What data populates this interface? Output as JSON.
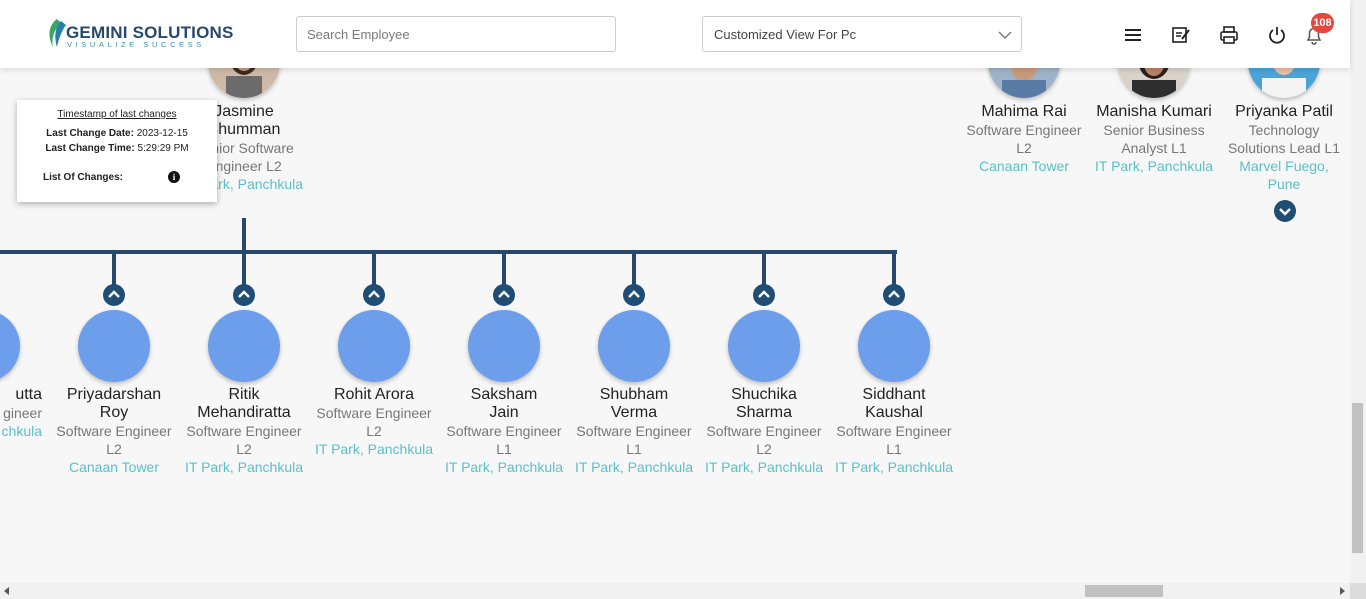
{
  "header": {
    "logo_name": "GEMINI SOLUTIONS",
    "logo_tagline": "VISUALIZE SUCCESS",
    "search_placeholder": "Search Employee",
    "view_select": "Customized View For Pc",
    "notification_count": "108",
    "icons": [
      "menu-icon",
      "edit-note-icon",
      "print-icon",
      "power-icon",
      "bell-icon"
    ]
  },
  "popup": {
    "title": "Timestamp of last changes",
    "date_label": "Last Change Date:",
    "date_value": "2023-12-15",
    "time_label": "Last Change Time:",
    "time_value": "5:29:29 PM",
    "changes_label": "List Of Changes:"
  },
  "manager": {
    "name": "Jasmine Bhumman",
    "role": "Senior Software Engineer L2",
    "location": "IT Park, Panchkula"
  },
  "top_right_nodes": [
    {
      "name": "Mahima Rai",
      "role": "Software Engineer L2",
      "location": "Canaan Tower"
    },
    {
      "name": "Manisha Kumari",
      "role": "Senior Business Analyst L1",
      "location": "IT Park, Panchkula"
    },
    {
      "name": "Priyanka Patil",
      "role": "Technology Solutions Lead L1",
      "location": "Marvel Fuego, Pune"
    }
  ],
  "children": [
    {
      "name": "utta",
      "role": "gineer",
      "location": "chkula"
    },
    {
      "name": "Priyadarshan Roy",
      "role": "Software Engineer L2",
      "location": "Canaan Tower"
    },
    {
      "name": "Ritik Mehandiratta",
      "role": "Software Engineer L2",
      "location": "IT Park, Panchkula"
    },
    {
      "name": "Rohit Arora",
      "role": "Software Engineer L2",
      "location": "IT Park, Panchkula"
    },
    {
      "name": "Saksham Jain",
      "role": "Software Engineer L1",
      "location": "IT Park, Panchkula"
    },
    {
      "name": "Shubham Verma",
      "role": "Software Engineer L1",
      "location": "IT Park, Panchkula"
    },
    {
      "name": "Shuchika Sharma",
      "role": "Software Engineer L2",
      "location": "IT Park, Panchkula"
    },
    {
      "name": "Siddhant Kaushal",
      "role": "Software Engineer L1",
      "location": "IT Park, Panchkula"
    }
  ],
  "colors": {
    "accent": "#27496d",
    "location": "#5bbfc9",
    "avatar": "#6d9eeb",
    "badge": "#e8453c"
  }
}
